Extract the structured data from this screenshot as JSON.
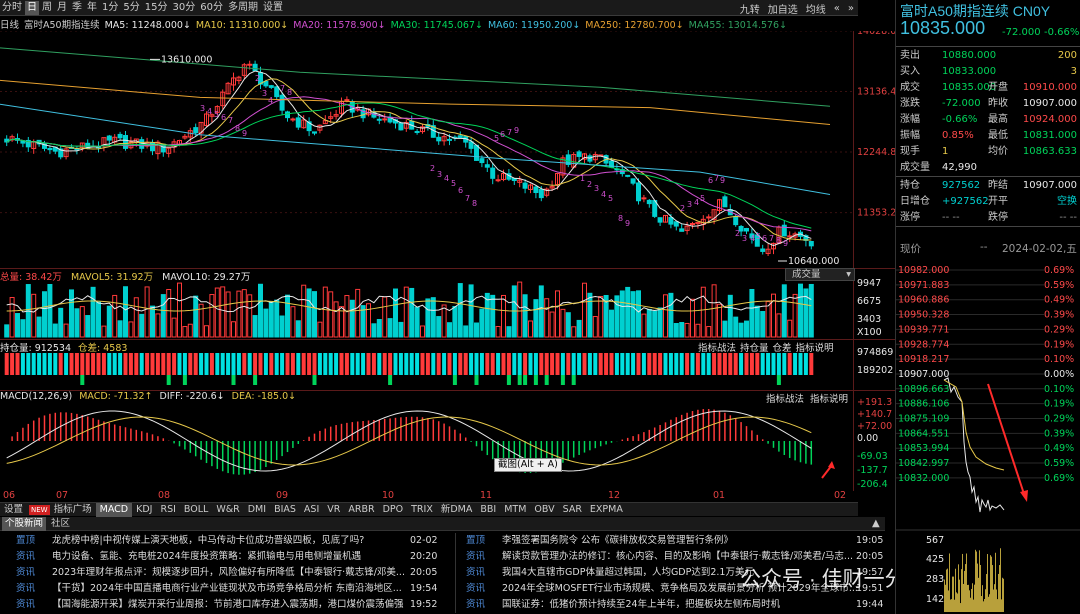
{
  "toolbar": {
    "periods": [
      "分时",
      "日",
      "周",
      "月",
      "季",
      "年",
      "1分",
      "5分",
      "15分",
      "30分",
      "60分",
      "多周期",
      "设置"
    ],
    "selected": "日",
    "right": [
      "九转",
      "加自选",
      "均线",
      "«",
      "»"
    ]
  },
  "ma_legend": {
    "title": "日线",
    "name": "富时A50期指连续",
    "items": [
      {
        "text": "MA5: 11248.000↓",
        "color": "#e8e8e8"
      },
      {
        "text": "MA10: 11310.000↓",
        "color": "#e6c84a"
      },
      {
        "text": "MA20: 11578.900↓",
        "color": "#d050d0"
      },
      {
        "text": "MA30: 11745.067↓",
        "color": "#00d45a"
      },
      {
        "text": "MA60: 11950.200↓",
        "color": "#40c0e0"
      },
      {
        "text": "MA250: 12780.700↓",
        "color": "#e6a030"
      },
      {
        "text": "MA455: 13014.576↓",
        "color": "#30a060"
      }
    ]
  },
  "price_axis": [
    "14028.06",
    "13136.46",
    "12244.87",
    "11353.27"
  ],
  "annotations": {
    "high": "13610.000",
    "low": "10640.000"
  },
  "vol_legend": {
    "total": "总量: 38.42万",
    "mavol5": "MAVOL5: 31.92万",
    "mavol10": "MAVOL10: 29.27万",
    "button": "成交量"
  },
  "vol_axis": [
    "9947",
    "6675",
    "3403",
    "X100"
  ],
  "oi_legend": {
    "total": "持仓量: 912534",
    "diff": "仓差: 4583",
    "buttons": [
      "指标战法",
      "持仓量",
      "仓差",
      "指标说明"
    ]
  },
  "oi_axis": [
    "974869",
    "189202"
  ],
  "macd_legend": {
    "main": "MACD(12,26,9)",
    "macd": "MACD: -71.32↑",
    "diff": "DIFF: -220.6↓",
    "dea": "DEA: -185.0↓",
    "buttons": [
      "指标战法",
      "指标说明"
    ]
  },
  "macd_axis": [
    "+191.3",
    "+140.7",
    "+72.00",
    "0.00",
    "-69.03",
    "-137.7",
    "-206.4"
  ],
  "tooltip": "截图(Alt + A)",
  "months": [
    "06",
    "07",
    "08",
    "09",
    "10",
    "11",
    "12",
    "01",
    "02"
  ],
  "tabs": [
    "设置",
    "指标广场",
    "MACD",
    "KDJ",
    "RSI",
    "BOLL",
    "W&R",
    "DMI",
    "BIAS",
    "ASI",
    "VR",
    "ARBR",
    "DPO",
    "TRIX",
    "新DMA",
    "BBI",
    "MTM",
    "OBV",
    "SAR",
    "EXPMA"
  ],
  "tabs_selected": "MACD",
  "tabs_new": "NEW",
  "news_tabs": [
    "个股新闻",
    "社区"
  ],
  "news_left": [
    {
      "tag": "置顶",
      "text": "龙虎榜中榜|中视传媒上演天地板，中马传动卡位成功晋级四板，见底了吗?",
      "time": "02-02"
    },
    {
      "tag": "资讯",
      "text": "电力设备、氢能、充电桩2024年度投资策略：紧抓输电与用电侧增量机遇",
      "time": "20:20"
    },
    {
      "tag": "资讯",
      "text": "2023年理财年报点评：规模逐步回升，风险偏好有所降低【中泰银行·戴志锋/邓美...",
      "time": "20:05"
    },
    {
      "tag": "资讯",
      "text": "【干货】2024年中国直播电商行业产业链现状及市场竞争格局分析 东南沿海地区...",
      "time": "19:54"
    },
    {
      "tag": "资讯",
      "text": "【国海能源开采】煤炭开采行业周报：节前港口库存进入震荡期，港口煤价震荡偏强",
      "time": "19:52"
    }
  ],
  "news_right": [
    {
      "tag": "置顶",
      "text": "李强签署国务院令 公布《碳排放权交易管理暂行条例》",
      "time": "19:05"
    },
    {
      "tag": "资讯",
      "text": "解读贷款管理办法的修订：核心内容、目的及影响【中泰银行·戴志锋/邓美君/马志...",
      "time": "20:05"
    },
    {
      "tag": "资讯",
      "text": "我国4大直辖市GDP体量超过韩国，人均GDP达到2.1万美元",
      "time": "19:57"
    },
    {
      "tag": "资讯",
      "text": "2024年全球MOSFET行业市场规模、竞争格局及发展前景分析 预计2029年全球市...",
      "time": "19:51"
    },
    {
      "tag": "资讯",
      "text": "国联证券：低猪价预计持续至24年上半年，把握板块左侧布局时机",
      "time": "19:44"
    }
  ],
  "watermark": "公众号 · 佳财一分钟",
  "quote": {
    "title": "富时A50期指连续 CN0Y",
    "price": "10835.000",
    "change": "-72.000",
    "pct": "-0.66%",
    "rows": [
      {
        "l1": "卖出",
        "v1": "10880.000",
        "c1": "green",
        "l2": "",
        "v2": "200",
        "c2": "yellow"
      },
      {
        "l1": "买入",
        "v1": "10833.000",
        "c1": "green",
        "l2": "",
        "v2": "3",
        "c2": "yellow"
      },
      {
        "l1": "成交",
        "v1": "10835.000",
        "c1": "green",
        "l2": "开盘",
        "v2": "10910.000",
        "c2": "red"
      },
      {
        "l1": "涨跌",
        "v1": "-72.000",
        "c1": "green",
        "l2": "昨收",
        "v2": "10907.000",
        "c2": "white"
      },
      {
        "l1": "涨幅",
        "v1": "-0.66%",
        "c1": "green",
        "l2": "最高",
        "v2": "10924.000",
        "c2": "red"
      },
      {
        "l1": "振幅",
        "v1": "0.85%",
        "c1": "red",
        "l2": "最低",
        "v2": "10831.000",
        "c2": "green"
      },
      {
        "l1": "现手",
        "v1": "1",
        "c1": "yellow",
        "l2": "均价",
        "v2": "10863.633",
        "c2": "green"
      },
      {
        "l1": "成交量",
        "v1": "42,990",
        "c1": "white",
        "l2": "",
        "v2": "",
        "c2": "white"
      },
      {
        "l1": "持仓",
        "v1": "927562",
        "c1": "cyan",
        "l2": "昨结",
        "v2": "10907.000",
        "c2": "white"
      },
      {
        "l1": "日增仓",
        "v1": "+927562",
        "c1": "cyan",
        "l2": "开平",
        "v2": "空换",
        "c2": "cyan"
      },
      {
        "l1": "涨停",
        "v1": "-- --",
        "c1": "gray",
        "l2": "跌停",
        "v2": "-- --",
        "c2": "gray"
      }
    ],
    "now_label": "现价",
    "now_value": "--",
    "date": "2024-02-02,五"
  },
  "intraday_axis_left": [
    "10982.000",
    "10971.883",
    "10960.886",
    "10950.328",
    "10939.771",
    "10928.774",
    "10918.217",
    "10907.000",
    "10896.663",
    "10886.106",
    "10875.109",
    "10864.551",
    "10853.994",
    "10842.997",
    "10832.000"
  ],
  "intraday_axis_right": [
    "0.69%",
    "0.59%",
    "0.49%",
    "0.39%",
    "0.29%",
    "0.19%",
    "0.10%",
    "0.00%",
    "0.10%",
    "0.19%",
    "0.29%",
    "0.39%",
    "0.49%",
    "0.59%",
    "0.69%"
  ],
  "intraday_vol_axis": [
    "567",
    "425",
    "283",
    "142"
  ],
  "chart_data": {
    "type": "candlestick",
    "title": "富时A50期指连续 日线",
    "x": [
      "06",
      "07",
      "08",
      "09",
      "10",
      "11",
      "12",
      "01",
      "02"
    ],
    "price_range": [
      10640.0,
      14028.06
    ],
    "high": 13610.0,
    "low": 10640.0,
    "last": 10835.0,
    "indicators": {
      "MA5": 11248.0,
      "MA10": 11310.0,
      "MA20": 11578.9,
      "MA30": 11745.067,
      "MA60": 11950.2,
      "MA250": 12780.7,
      "MA455": 13014.576,
      "MACD": -71.32,
      "DIFF": -220.6,
      "DEA": -185.0,
      "volume_total": "38.42万",
      "open_interest": 912534,
      "oi_diff": 4583
    }
  }
}
